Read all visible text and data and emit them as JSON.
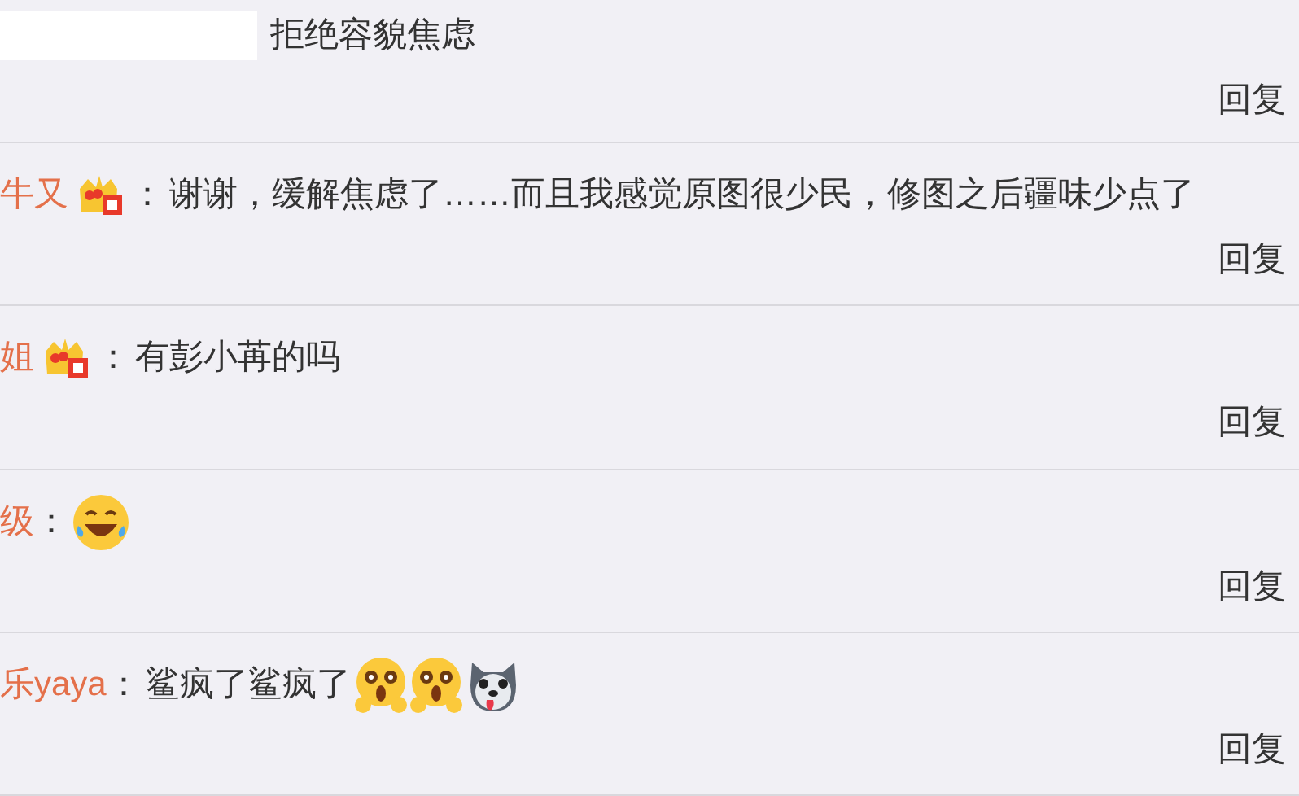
{
  "comments": [
    {
      "redacted": true,
      "text": "拒绝容貌焦虑",
      "reply": "回复"
    },
    {
      "author": "牛又",
      "crown_badge": true,
      "separator": "：",
      "text": "谢谢，缓解焦虑了……而且我感觉原图很少民，修图之后疆味少点了",
      "reply": "回复"
    },
    {
      "author": "姐",
      "crown_badge": true,
      "separator": "：",
      "text": "有彭小苒的吗",
      "reply": "回复"
    },
    {
      "author": "级",
      "separator": "：",
      "emojis": [
        {
          "kind": "laughing"
        }
      ],
      "reply": "回复"
    },
    {
      "author": "乐yaya",
      "separator": "：",
      "text": "鲨疯了鲨疯了",
      "emojis": [
        {
          "kind": "shocked"
        },
        {
          "kind": "shocked"
        },
        {
          "kind": "dog"
        }
      ],
      "reply": "回复"
    }
  ]
}
